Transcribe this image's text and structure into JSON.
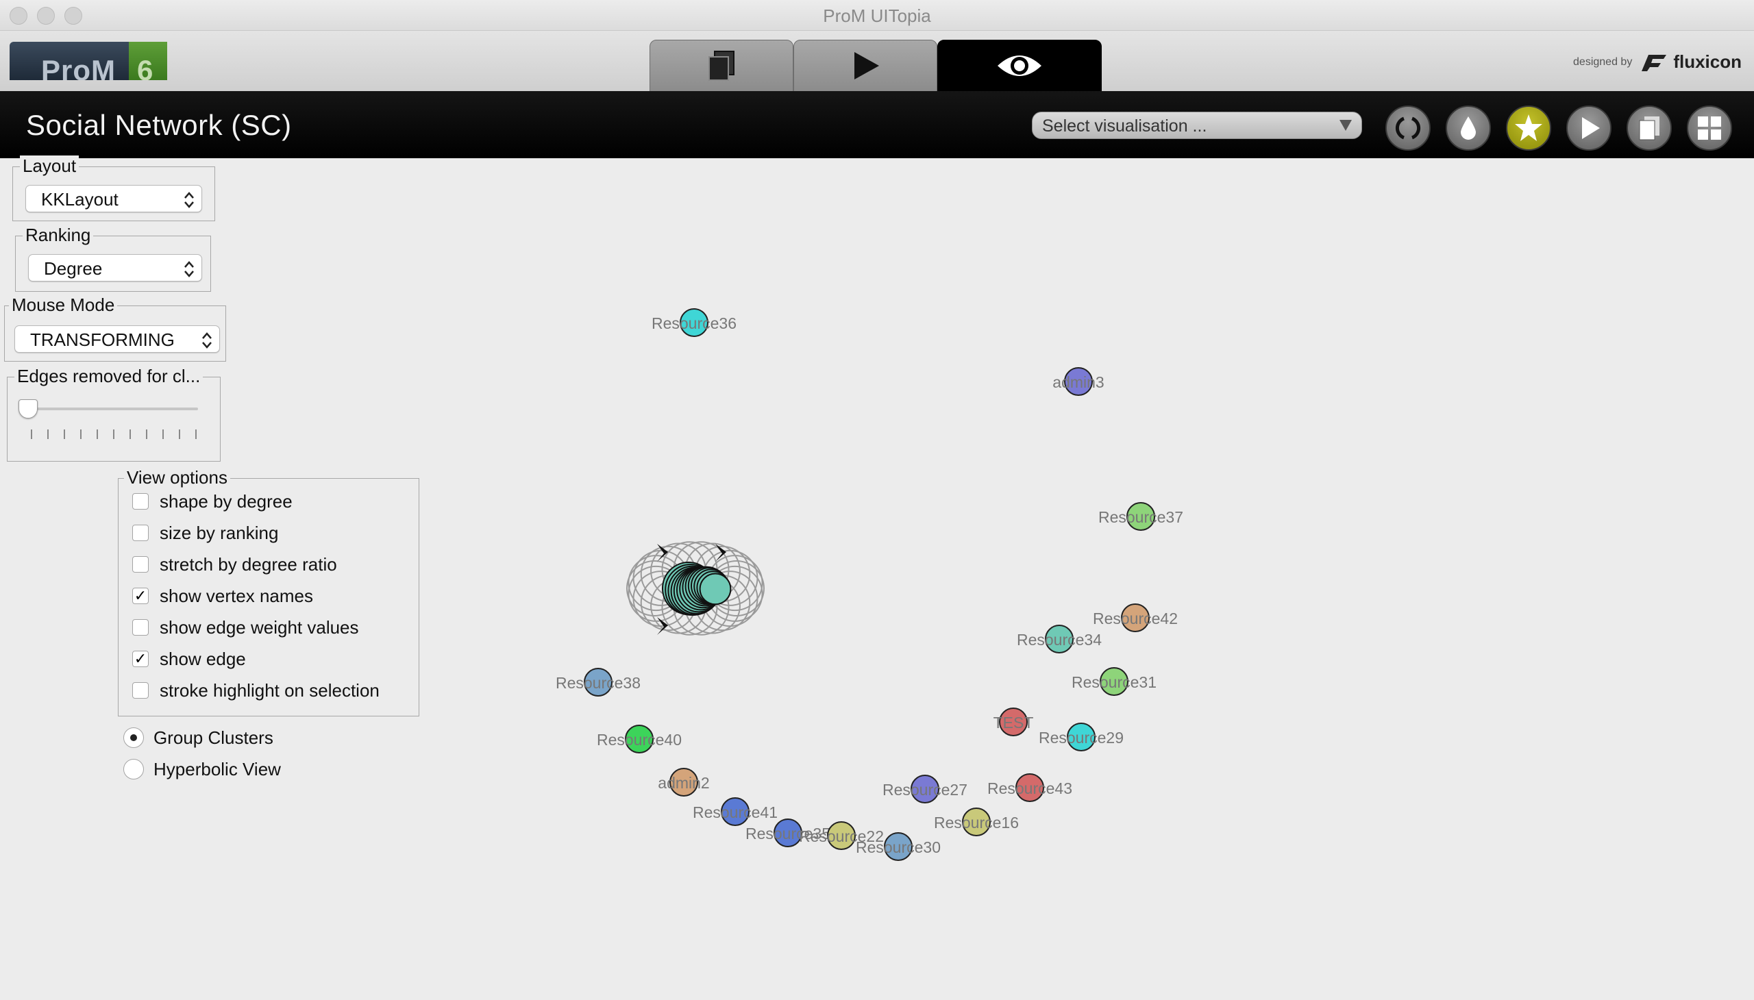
{
  "window": {
    "title": "ProM UITopia"
  },
  "logo": {
    "name": "ProM",
    "version": "6"
  },
  "brand": {
    "designed_by": "designed by",
    "company": "fluxicon"
  },
  "mode_tabs": [
    {
      "name": "workspace-tab",
      "icon": "documents-icon"
    },
    {
      "name": "actions-tab",
      "icon": "play-icon"
    },
    {
      "name": "views-tab",
      "icon": "eye-icon",
      "active": true
    }
  ],
  "header": {
    "title": "Social Network (SC)",
    "visualisation_select": "Select visualisation ...",
    "tools": [
      {
        "name": "refresh-view-button",
        "icon": "refresh-icon"
      },
      {
        "name": "color-button",
        "icon": "drop-icon"
      },
      {
        "name": "favorite-button",
        "icon": "star-icon",
        "active": true
      },
      {
        "name": "play-button",
        "icon": "play-icon"
      },
      {
        "name": "copy-button",
        "icon": "documents-icon"
      },
      {
        "name": "grid-button",
        "icon": "grid-icon"
      }
    ]
  },
  "panel": {
    "layout": {
      "title": "Layout",
      "value": "KKLayout"
    },
    "ranking": {
      "title": "Ranking",
      "value": "Degree"
    },
    "mouse_mode": {
      "title": "Mouse Mode",
      "value": "TRANSFORMING"
    },
    "edges": {
      "title": "Edges removed for cl...",
      "slider_value": 0
    },
    "view_options": {
      "title": "View options",
      "items": [
        {
          "label": "shape by degree",
          "checked": false
        },
        {
          "label": "size by ranking",
          "checked": false
        },
        {
          "label": "stretch by degree ratio",
          "checked": false
        },
        {
          "label": "show vertex names",
          "checked": true
        },
        {
          "label": "show edge weight values",
          "checked": false
        },
        {
          "label": "show edge",
          "checked": true
        },
        {
          "label": "stroke highlight on selection",
          "checked": false
        }
      ]
    },
    "radios": [
      {
        "label": "Group Clusters",
        "selected": true
      },
      {
        "label": "Hyperbolic View",
        "selected": false
      }
    ]
  },
  "graph": {
    "nodes": [
      {
        "label": "Resource36",
        "color": "#3fd6d6"
      },
      {
        "label": "admin3",
        "color": "#7a7ad4"
      },
      {
        "label": "Resource37",
        "color": "#8ed47a"
      },
      {
        "label": "Resource42",
        "color": "#d4a47a"
      },
      {
        "label": "Resource34",
        "color": "#6fc9b5"
      },
      {
        "label": "Resource38",
        "color": "#7aa4c9"
      },
      {
        "label": "Resource31",
        "color": "#8ed47a"
      },
      {
        "label": "TEST",
        "color": "#d46a6a"
      },
      {
        "label": "Resource29",
        "color": "#3fd6d6"
      },
      {
        "label": "Resource40",
        "color": "#3cd45a"
      },
      {
        "label": "admin2",
        "color": "#d4a47a"
      },
      {
        "label": "Resource27",
        "color": "#7a7ad4"
      },
      {
        "label": "Resource43",
        "color": "#d46a6a"
      },
      {
        "label": "Resource16",
        "color": "#c9c97a"
      },
      {
        "label": "Resource41",
        "color": "#5a7ad4"
      },
      {
        "label": "Resource35",
        "color": "#5a7ad4"
      },
      {
        "label": "Resource22",
        "color": "#c9c97a"
      },
      {
        "label": "Resource30",
        "color": "#7aa4c9"
      }
    ],
    "cluster_color": "#6fc9b5"
  }
}
